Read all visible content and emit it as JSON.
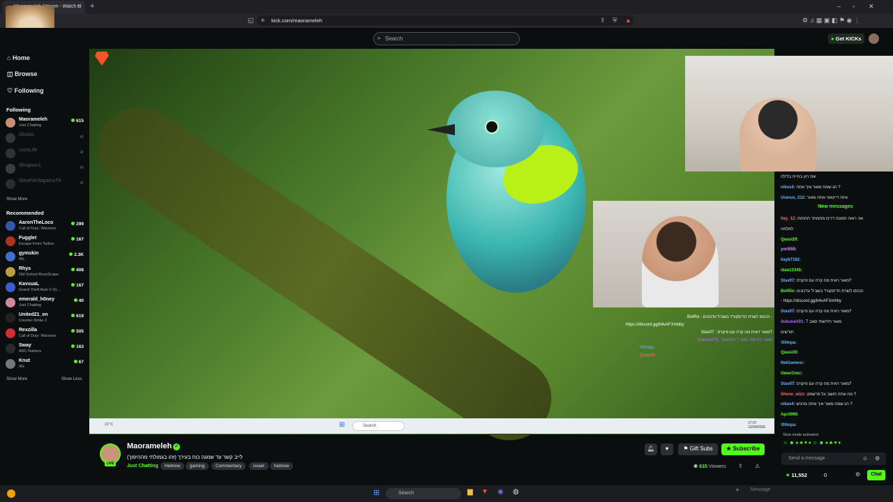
{
  "browser": {
    "tab_title": "Maorameleh Stream - Watch Li",
    "url": "kick.com/maorameleh"
  },
  "header": {
    "search_placeholder": "Search",
    "get_kicks": "Get KICKs"
  },
  "sidebar": {
    "nav": [
      {
        "label": "Home"
      },
      {
        "label": "Browse"
      },
      {
        "label": "Following"
      }
    ],
    "following_title": "Following",
    "following": [
      {
        "name": "Maorameleh",
        "category": "Just Chatting",
        "viewers": "615",
        "live": true,
        "color": "#c98e74"
      },
      {
        "name": "Shotist",
        "category": "",
        "viewers": "",
        "live": false,
        "color": "#888"
      },
      {
        "name": "LiorsLife",
        "category": "",
        "viewers": "",
        "live": false,
        "color": "#777"
      },
      {
        "name": "Shogoon1",
        "category": "",
        "viewers": "",
        "live": false,
        "color": "#999"
      },
      {
        "name": "SteveVeSagarnuTK",
        "category": "",
        "viewers": "",
        "live": false,
        "color": "#666"
      }
    ],
    "show_more": "Show More",
    "recommended_title": "Recommended",
    "recommended": [
      {
        "name": "AaronTheLoco",
        "category": "Call of Duty: Warzone",
        "viewers": "299",
        "color": "#3355aa"
      },
      {
        "name": "Fugglet",
        "category": "Escape From Tarkov",
        "viewers": "167",
        "color": "#aa3322"
      },
      {
        "name": "gymskin",
        "category": "IRL",
        "viewers": "2.3K",
        "color": "#3d6fd1"
      },
      {
        "name": "Rhys",
        "category": "Old School RuneScape",
        "viewers": "408",
        "color": "#c09a40"
      },
      {
        "name": "KavsuaL",
        "category": "Grand Theft Auto V (G...",
        "viewers": "167",
        "color": "#3a5fcc"
      },
      {
        "name": "emerald_h0ney",
        "category": "Just Chatting",
        "viewers": "40",
        "color": "#d08a9a"
      },
      {
        "name": "United21_en",
        "category": "Counter-Strike 2",
        "viewers": "619",
        "color": "#222"
      },
      {
        "name": "Rexzilla",
        "category": "Call of Duty: Warzone",
        "viewers": "505",
        "color": "#cc3030"
      },
      {
        "name": "Sway",
        "category": "ARC Raiders",
        "viewers": "163",
        "color": "#2a2a2a"
      },
      {
        "name": "Knut",
        "category": "IRL",
        "viewers": "67",
        "color": "#777"
      }
    ],
    "show_more_2": "Show More",
    "show_less": "Show Less"
  },
  "video": {
    "overlay_chat": [
      "BotRix : הכנסו לשרת הדיסקורד בשביל עדכונים -",
      "https://discord.gg/b4vAFXmhby",
      "Stav07 : מאור ראית מה קרה עם פיקרס?",
      "SukunaV01 : מאור חידשתי סאב 7 חודשים",
      "!00mpa",
      "Quasi29"
    ],
    "taskbar_search": "Search",
    "weather": "21°C",
    "clock": "17:07",
    "date": "13/04/2026"
  },
  "stream": {
    "channel_name": "Maorameleh",
    "live_label": "LIVE",
    "title": "לייב קשר עד שמגה כוח בעירך (זהו בגמולתי מההיפוך)",
    "category": "Just Chatting",
    "tags": [
      "Hebrew",
      "gaming",
      "Commentary",
      "israel",
      "hebrew"
    ],
    "gift_subs": "Gift Subs",
    "subscribe": "Subscribe",
    "viewers_count": "615",
    "viewers_label": "Viewers"
  },
  "chat": {
    "messages": [
      {
        "user": "",
        "text": "את רוץ בחייה בלילה",
        "color": "#fff"
      },
      {
        "user": "nikes4:",
        "text": "הג שמח מאור איך אתה ?",
        "color": "#5fb7ff"
      },
      {
        "user": "Uranus_212:",
        "text": "איזה דייטאני אתה מאור",
        "color": "#5fb7ff"
      }
    ],
    "new_messages": "New messages",
    "messages2": [
      {
        "user": "Itay_12:",
        "text": "אני רואה תמונה דרים מתמתר תחתות",
        "color": "#ff6a6a"
      },
      {
        "user": "",
        "text": "למלמה",
        "color": "#fff"
      },
      {
        "user": "Quasi29:",
        "text": "",
        "color": "#53fc18"
      },
      {
        "user": "yori555:",
        "text": "",
        "color": "#d99cff"
      },
      {
        "user": "Ilayb7182:",
        "text": "",
        "color": "#5fb7ff"
      },
      {
        "user": "idan12345:",
        "text": "",
        "color": "#53fc18"
      },
      {
        "user": "Stav07:",
        "text": "מאור ראית מה קרה עם פיקרס?",
        "color": "#5fb7ff"
      },
      {
        "user": "BotRix:",
        "text": "הכנסו לשרת הדיסקורד בשביל עדכונים",
        "color": "#53fc18"
      },
      {
        "user": "",
        "text": "- https://discord.gg/b4vAFXmhby",
        "color": "#fff"
      },
      {
        "user": "Stav07:",
        "text": "מאור ראית מה קרה עם פיקרס?",
        "color": "#5fb7ff"
      },
      {
        "user": "SukunaV01:",
        "text": "מאור חידשתי סאב 7",
        "color": "#b56bff"
      },
      {
        "user": "",
        "text": "חודשים",
        "color": "#fff"
      },
      {
        "user": "!00mpa:",
        "text": "",
        "color": "#5fb7ff"
      },
      {
        "user": "Quasi29:",
        "text": "",
        "color": "#53fc18"
      },
      {
        "user": "NetGamesr:",
        "text": "",
        "color": "#5fb7ff"
      },
      {
        "user": "OmerGrec:",
        "text": "",
        "color": "#53fc18"
      },
      {
        "user": "Stav07:",
        "text": "מאור ראית מה קרה עם פיקרס?",
        "color": "#5fb7ff"
      },
      {
        "user": "Shene_wizz:",
        "text": "מה אתה חושב על פרשמט ?",
        "color": "#ff6a6a"
      },
      {
        "user": "nikes4:",
        "text": "הג שמח מאור איך אתה מרגיש ?",
        "color": "#5fb7ff"
      },
      {
        "user": "April999:",
        "text": "",
        "color": "#53fc18"
      },
      {
        "user": "!00mpa:",
        "text": "",
        "color": "#5fb7ff"
      }
    ],
    "slow_mode": "Slow mode activated",
    "input_placeholder": "Send a message",
    "points": "11,552",
    "zero": "0",
    "chat_button": "Chat"
  },
  "taskbar": {
    "search": "Search",
    "message_label": "Message"
  }
}
